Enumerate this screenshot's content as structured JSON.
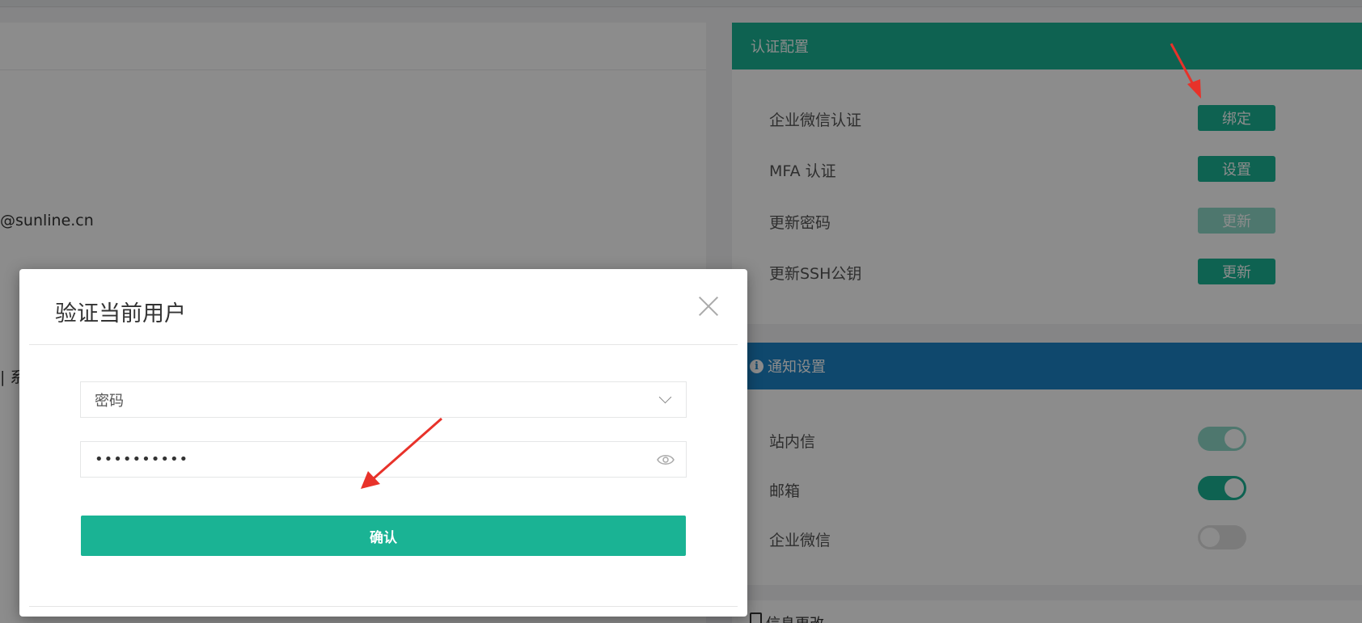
{
  "background": {
    "email_fragment": "@sunline.cn",
    "tab_fragment": "| 系"
  },
  "auth_card": {
    "title": "认证配置",
    "rows": [
      {
        "label": "企业微信认证",
        "button": "绑定"
      },
      {
        "label": "MFA 认证",
        "button": "设置"
      },
      {
        "label": "更新密码",
        "button": "更新"
      },
      {
        "label": "更新SSH公钥",
        "button": "更新"
      }
    ]
  },
  "notify_card": {
    "title": "通知设置",
    "rows": [
      {
        "label": "站内信",
        "enabled": true
      },
      {
        "label": "邮箱",
        "enabled": true
      },
      {
        "label": "企业微信",
        "enabled": false
      }
    ]
  },
  "info_card": {
    "title": "信息更改"
  },
  "modal": {
    "title": "验证当前用户",
    "auth_method": "密码",
    "password_mask": "••••••••••",
    "confirm_label": "确认"
  },
  "colors": {
    "primary": "#1ab394",
    "info": "#1c84c6",
    "annotation_arrow": "#e8322a"
  }
}
